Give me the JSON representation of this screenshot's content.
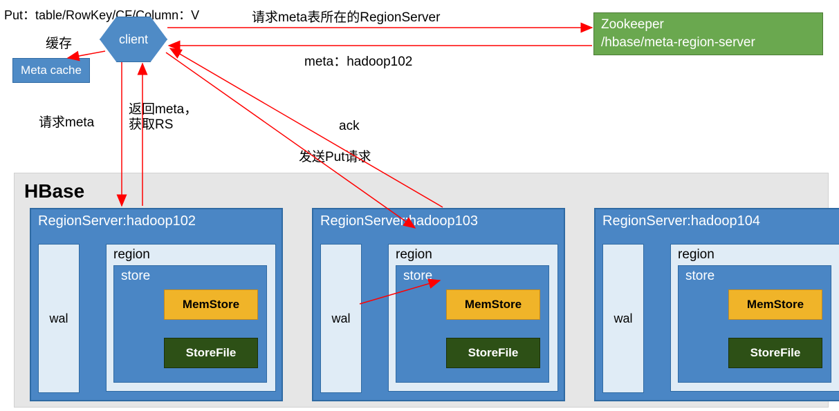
{
  "put_command": "Put：table/RowKey/CF/Column：V",
  "labels": {
    "cache": "缓存",
    "req_meta": "请求meta",
    "ret_meta_line1": "返回meta，",
    "ret_meta_line2": "获取RS",
    "req_zk": "请求meta表所在的RegionServer",
    "meta_hadoop": "meta：hadoop102",
    "ack": "ack",
    "send_put": "发送Put请求"
  },
  "nodes": {
    "client": "client",
    "meta_cache": "Meta cache",
    "zookeeper_line1": "Zookeeper",
    "zookeeper_line2": "/hbase/meta-region-server"
  },
  "hbase": {
    "title": "HBase",
    "region_servers": [
      {
        "title": "RegionServer:hadoop102"
      },
      {
        "title": "RegionServer:hadoop103"
      },
      {
        "title": "RegionServer:hadoop104"
      }
    ],
    "box_labels": {
      "wal": "wal",
      "region": "region",
      "store": "store",
      "memstore": "MemStore",
      "storefile": "StoreFile"
    }
  }
}
